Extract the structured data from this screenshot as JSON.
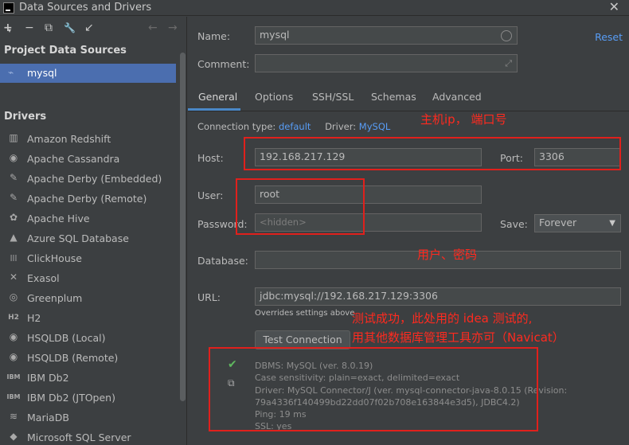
{
  "window": {
    "title": "Data Sources and Drivers"
  },
  "toolbar": {
    "add": "+",
    "remove": "−",
    "copy": "⧉",
    "settings": "🔧",
    "import": "↙",
    "back": "←",
    "forward": "→"
  },
  "left": {
    "project_title": "Project Data Sources",
    "selected_source": "mysql",
    "drivers_title": "Drivers",
    "drivers": [
      {
        "label": "Amazon Redshift",
        "icon": "▥"
      },
      {
        "label": "Apache Cassandra",
        "icon": "◉"
      },
      {
        "label": "Apache Derby (Embedded)",
        "icon": "✎"
      },
      {
        "label": "Apache Derby (Remote)",
        "icon": "✎"
      },
      {
        "label": "Apache Hive",
        "icon": "✿"
      },
      {
        "label": "Azure SQL Database",
        "icon": "▲"
      },
      {
        "label": "ClickHouse",
        "icon": "|||"
      },
      {
        "label": "Exasol",
        "icon": "✕"
      },
      {
        "label": "Greenplum",
        "icon": "◎"
      },
      {
        "label": "H2",
        "icon": "H2"
      },
      {
        "label": "HSQLDB (Local)",
        "icon": "◉"
      },
      {
        "label": "HSQLDB (Remote)",
        "icon": "◉"
      },
      {
        "label": "IBM Db2",
        "icon": "IBM"
      },
      {
        "label": "IBM Db2 (JTOpen)",
        "icon": "IBM"
      },
      {
        "label": "MariaDB",
        "icon": "≋"
      },
      {
        "label": "Microsoft SQL Server",
        "icon": "◆"
      }
    ]
  },
  "form": {
    "name_label": "Name:",
    "name_value": "mysql",
    "reset": "Reset",
    "comment_label": "Comment:",
    "tabs": [
      "General",
      "Options",
      "SSH/SSL",
      "Schemas",
      "Advanced"
    ],
    "conn_type_label": "Connection type:",
    "conn_type_value": "default",
    "driver_label": "Driver:",
    "driver_value": "MySQL",
    "host_label": "Host:",
    "host_value": "192.168.217.129",
    "port_label": "Port:",
    "port_value": "3306",
    "user_label": "User:",
    "user_value": "root",
    "password_label": "Password:",
    "password_placeholder": "<hidden>",
    "save_label": "Save:",
    "save_value": "Forever",
    "database_label": "Database:",
    "url_label": "URL:",
    "url_value": "jdbc:mysql://192.168.217.129:3306",
    "url_note": "Overrides settings above",
    "test_button": "Test Connection"
  },
  "result": {
    "lines": [
      "DBMS: MySQL (ver. 8.0.19)",
      "Case sensitivity: plain=exact, delimited=exact",
      "Driver: MySQL Connector/J (ver. mysql-connector-java-8.0.15 (Revision:",
      "79a4336f140499bd22dd07f02b708e163844e3d5), JDBC4.2)",
      "Ping: 19 ms",
      "SSL: yes"
    ]
  },
  "annotations": {
    "host_port": "主机ip， 端口号",
    "user_pass": "用户、密码",
    "test_line1": "测试成功，此处用的 idea 测试的,",
    "test_line2": "用其他数据库管理工具亦可（Navicat）"
  }
}
